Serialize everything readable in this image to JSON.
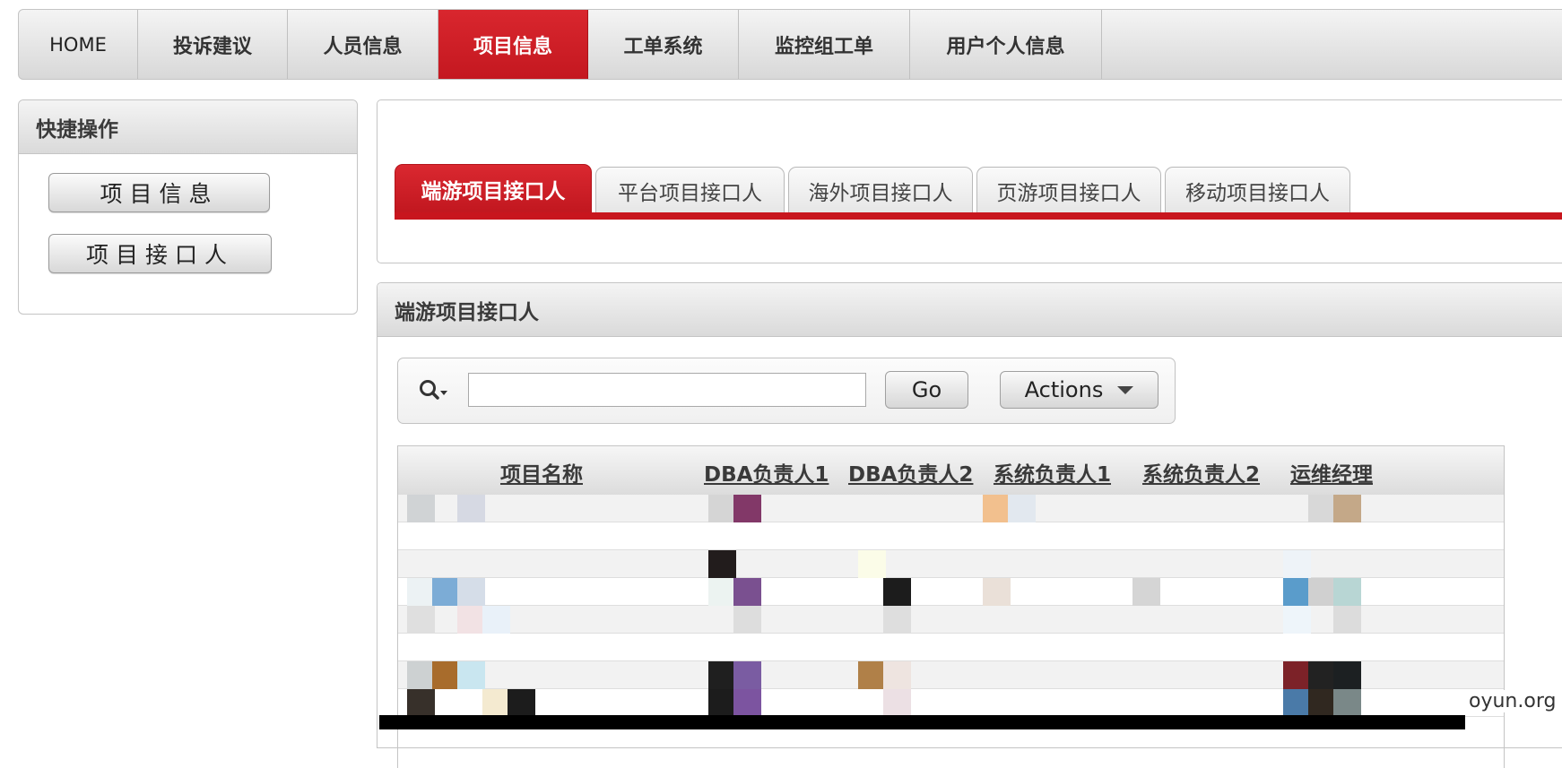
{
  "nav": {
    "items": [
      {
        "label": "HOME",
        "active": false
      },
      {
        "label": "投诉建议",
        "active": false
      },
      {
        "label": "人员信息",
        "active": false
      },
      {
        "label": "项目信息",
        "active": true
      },
      {
        "label": "工单系统",
        "active": false
      },
      {
        "label": "监控组工单",
        "active": false
      },
      {
        "label": "用户个人信息",
        "active": false
      }
    ]
  },
  "quick_ops": {
    "title": "快捷操作",
    "buttons": [
      "项目信息",
      "项目接口人"
    ]
  },
  "tabs": [
    {
      "label": "端游项目接口人",
      "active": true
    },
    {
      "label": "平台项目接口人",
      "active": false
    },
    {
      "label": "海外项目接口人",
      "active": false
    },
    {
      "label": "页游项目接口人",
      "active": false
    },
    {
      "label": "移动项目接口人",
      "active": false
    }
  ],
  "report": {
    "title": "端游项目接口人",
    "search": {
      "value": "",
      "placeholder": ""
    },
    "go_label": "Go",
    "actions_label": "Actions",
    "columns": [
      "项目名称",
      "DBA负责人1",
      "DBA负责人2",
      "系统负责人1",
      "系统负责人2",
      "运维经理"
    ]
  },
  "watermark": "oyun.org",
  "colors": {
    "accent": "#c8161e",
    "accent_light": "#d9262e"
  }
}
